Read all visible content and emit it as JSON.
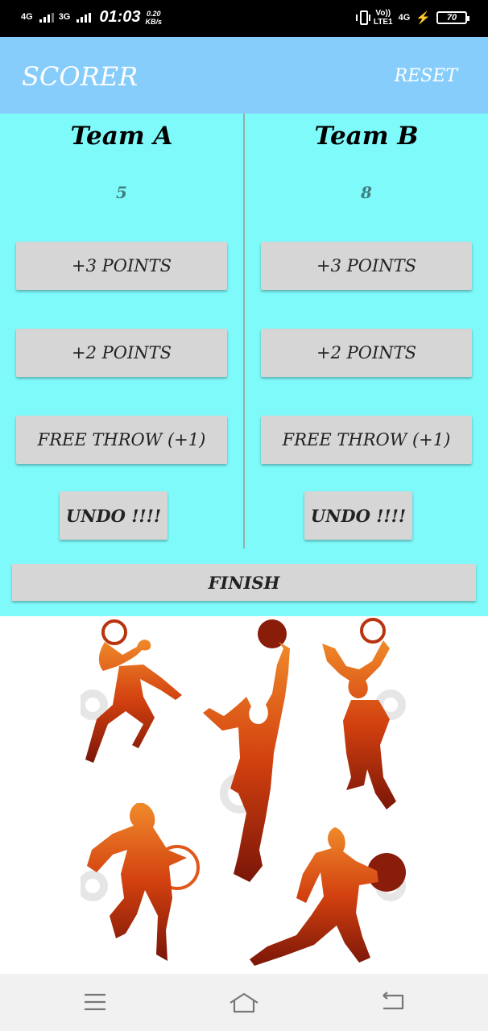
{
  "status_bar": {
    "net1": "4G",
    "net2": "3G",
    "time": "01:03",
    "speed_value": "0.20",
    "speed_unit": "KB/s",
    "volte_top": "Vo))",
    "volte_bottom": "LTE1",
    "net3": "4G",
    "battery": "70"
  },
  "app_bar": {
    "title": "SCORER",
    "reset_label": "RESET"
  },
  "team_a": {
    "name": "Team A",
    "score": "5",
    "plus3": "+3 POINTS",
    "plus2": "+2 POINTS",
    "free_throw": "FREE THROW (+1)",
    "undo": "UNDO !!!!"
  },
  "team_b": {
    "name": "Team B",
    "score": "8",
    "plus3": "+3 POINTS",
    "plus2": "+2 POINTS",
    "free_throw": "FREE THROW (+1)",
    "undo": "UNDO !!!!"
  },
  "finish_label": "FINISH",
  "colors": {
    "appbar": "#87cdfb",
    "panel": "#7ffafa",
    "button": "#d6d6d6",
    "score_text": "#3f7f80",
    "player_orange": "#e2571a",
    "player_dark": "#7a1608"
  },
  "nav_icons": [
    "menu-icon",
    "home-icon",
    "back-icon"
  ]
}
